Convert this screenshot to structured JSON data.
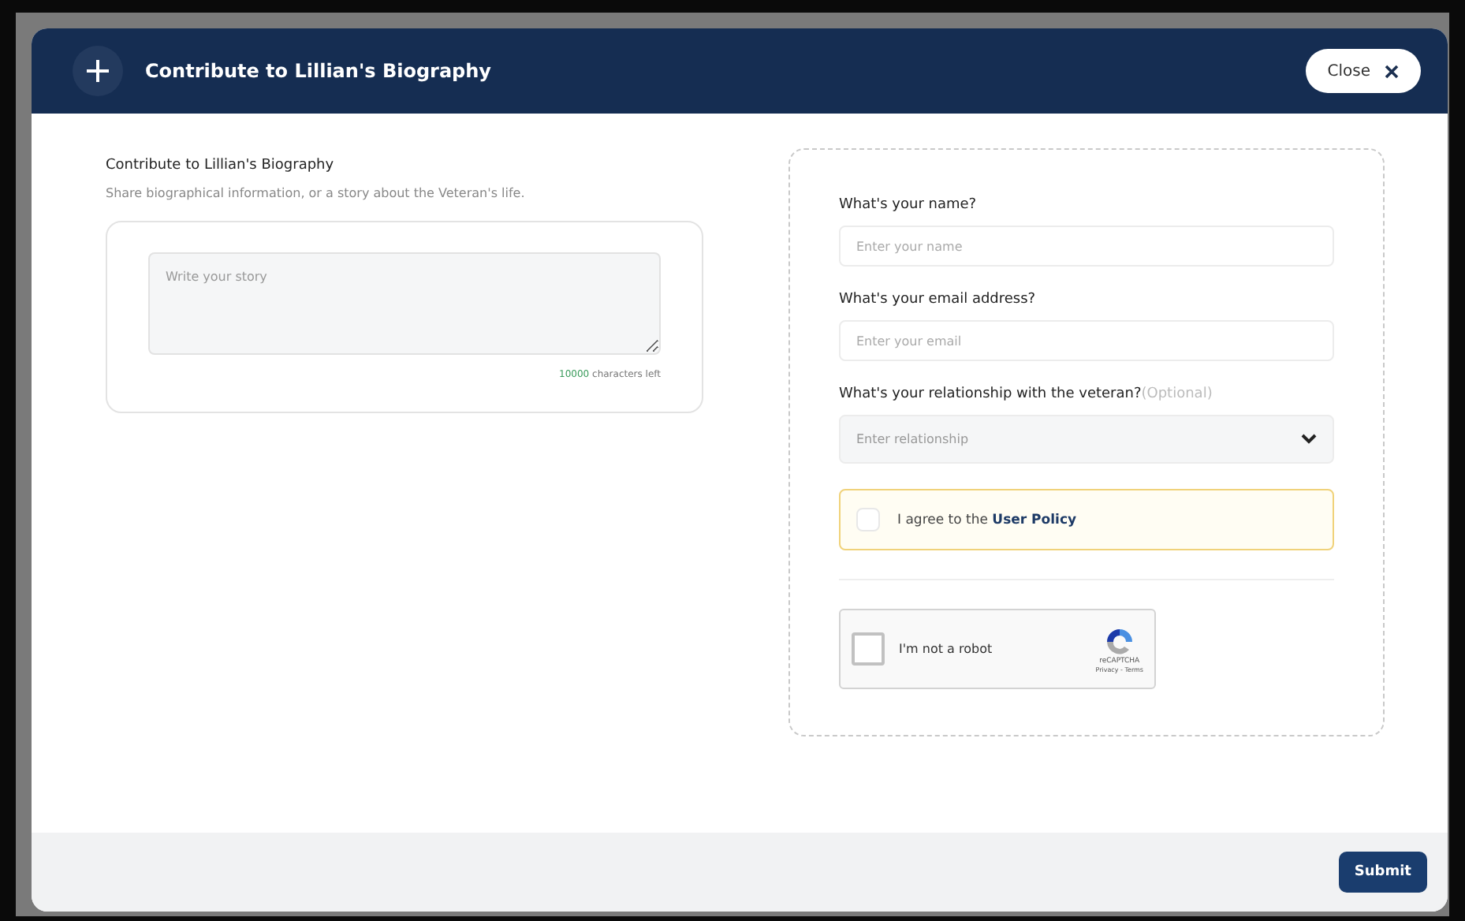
{
  "modal": {
    "title": "Contribute to Lillian's Biography",
    "close_label": "Close"
  },
  "story": {
    "heading": "Contribute to Lillian's Biography",
    "description": "Share biographical information, or a story about the Veteran's life.",
    "placeholder": "Write your story",
    "count": "10000",
    "count_suffix": "characters left"
  },
  "form": {
    "fields": [
      {
        "kind": "text",
        "label": "What's your name?",
        "placeholder": "Enter your name"
      },
      {
        "kind": "text",
        "label": "What's your email address?",
        "placeholder": "Enter your email"
      },
      {
        "kind": "select",
        "label": "What's your relationship with the veteran?",
        "note": "(Optional)",
        "placeholder": "Enter relationship"
      }
    ],
    "agreement": {
      "text": "I agree to the",
      "link": "User Policy",
      "checked": false
    },
    "captcha": {
      "label": "I'm not a robot",
      "brand": "reCAPTCHA",
      "links": "Privacy - Terms",
      "checked": false
    }
  },
  "footer": {
    "submit": "Submit"
  }
}
